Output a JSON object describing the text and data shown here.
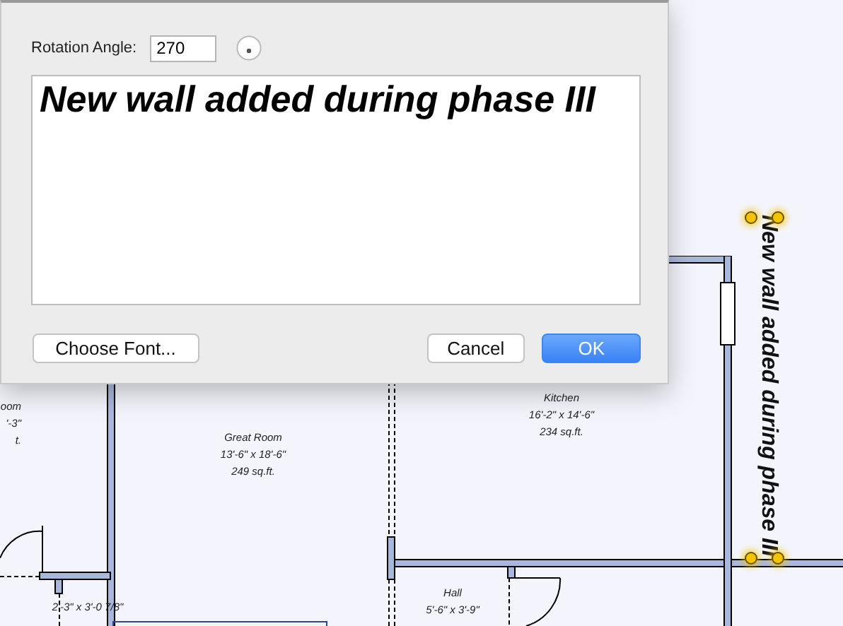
{
  "dialog": {
    "rotation_label": "Rotation Angle:",
    "rotation_value": "270",
    "text": "New wall added during phase III",
    "buttons": [
      {
        "label": "Choose Font...",
        "kind": "plain"
      },
      {
        "label": "Cancel",
        "kind": "plain"
      },
      {
        "label": "OK",
        "kind": "default"
      }
    ]
  },
  "plan": {
    "rooms": [
      {
        "lines": [
          "oom",
          "'-3\"",
          "t."
        ]
      },
      {
        "lines": [
          "Great Room",
          "13'-6\" x 18'-6\"",
          "249 sq.ft."
        ]
      },
      {
        "lines": [
          "Kitchen",
          "16'-2\" x 14'-6\"",
          "234 sq.ft."
        ]
      },
      {
        "lines": [
          "2'-3\" x 3'-0 7/8\""
        ]
      },
      {
        "lines": [
          "Hall",
          "5'-6\" x 3'-9\""
        ]
      }
    ],
    "annotation": {
      "text": "New wall added during phase III",
      "selected": true
    }
  }
}
